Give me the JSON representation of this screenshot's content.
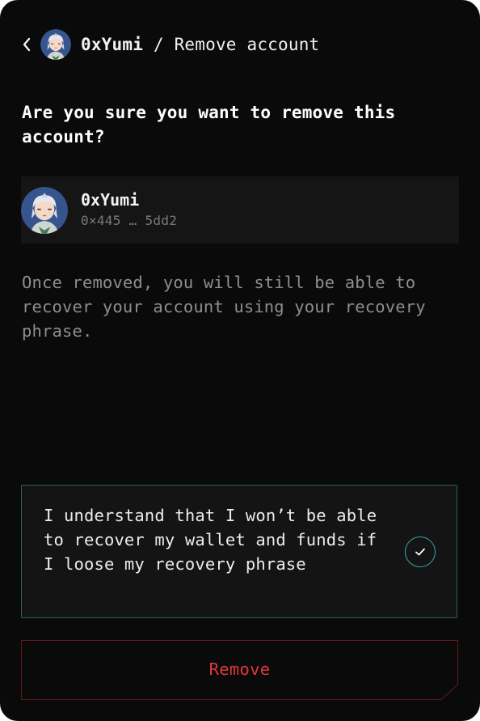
{
  "header": {
    "account_name": "0xYumi",
    "separator": " / ",
    "page_title": "Remove account",
    "back_icon": "chevron-left-icon"
  },
  "question": "Are you sure you want to remove this account?",
  "account": {
    "name": "0xYumi",
    "address": "0×445 … 5dd2",
    "avatar": "avatar-anime-character"
  },
  "info_text": "Once removed, you will still be able to recover your account using your recovery phrase.",
  "acknowledgement": {
    "text": "I understand that I won’t be able to recover my wallet and funds if I loose my recovery phrase",
    "checked": true,
    "check_icon": "checkmark-icon"
  },
  "remove_button": {
    "label": "Remove"
  },
  "colors": {
    "background": "#0a0a0b",
    "card": "#151516",
    "accent_teal": "#3aa6a3",
    "danger": "#e0383a",
    "muted_text": "#8e8e90"
  }
}
